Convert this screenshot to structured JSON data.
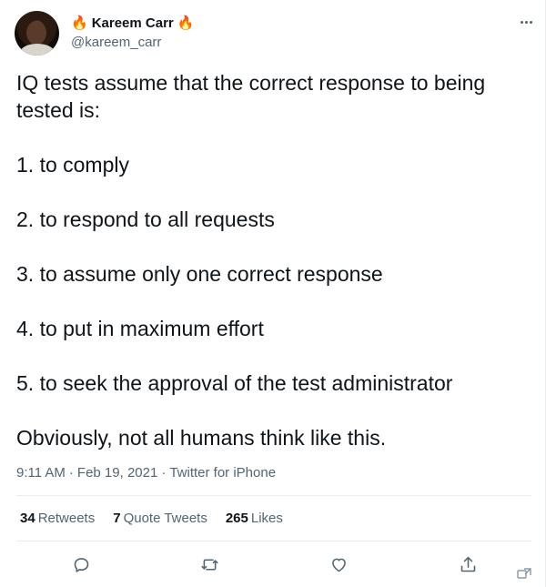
{
  "author": {
    "fire_emoji": "🔥",
    "display_name": "Kareem Carr",
    "handle": "@kareem_carr"
  },
  "tweet": {
    "intro": "IQ tests assume that the correct response to being tested is:",
    "items": [
      "1. to comply",
      "2. to respond to all requests",
      "3. to assume only one correct response",
      "4. to put in maximum effort",
      "5. to seek the approval of the test administrator"
    ],
    "outro": "Obviously, not all humans think like this."
  },
  "meta": {
    "time": "9:11 AM",
    "separator": "·",
    "date": "Feb 19, 2021",
    "client": "Twitter for iPhone"
  },
  "stats": {
    "retweets_count": "34",
    "retweets_label": "Retweets",
    "quotes_count": "7",
    "quotes_label": "Quote Tweets",
    "likes_count": "265",
    "likes_label": "Likes"
  },
  "icons": {
    "reply": "reply-icon",
    "retweet": "retweet-icon",
    "like": "like-icon",
    "share": "share-icon",
    "more": "more-icon"
  }
}
